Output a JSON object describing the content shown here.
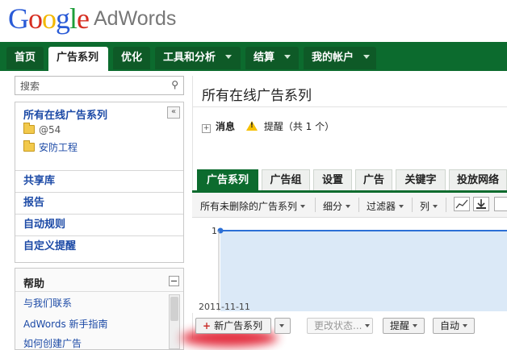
{
  "logo": {
    "brand_letters": [
      "G",
      "o",
      "o",
      "g",
      "l",
      "e"
    ],
    "product": "AdWords"
  },
  "nav": {
    "tabs": [
      {
        "label": "首页",
        "active": false,
        "dropdown": false
      },
      {
        "label": "广告系列",
        "active": true,
        "dropdown": false
      },
      {
        "label": "优化",
        "active": false,
        "dropdown": false
      },
      {
        "label": "工具和分析",
        "active": false,
        "dropdown": true
      },
      {
        "label": "结算",
        "active": false,
        "dropdown": true
      },
      {
        "label": "我的帐户",
        "active": false,
        "dropdown": true
      }
    ]
  },
  "sidebar": {
    "search_placeholder": "搜索",
    "tree_title": "所有在线广告系列",
    "collapse_label": "«",
    "campaigns": [
      "@54",
      "安防工程"
    ],
    "links": [
      "共享库",
      "报告",
      "自动规则",
      "自定义提醒"
    ],
    "help": {
      "title": "帮助",
      "links": [
        "与我们联系",
        "AdWords 新手指南",
        "如何创建广告"
      ]
    }
  },
  "main": {
    "page_title": "所有在线广告系列",
    "messages_label": "消息",
    "alerts_label": "提醒（共 1 个）",
    "tabs": [
      "广告系列",
      "广告组",
      "设置",
      "广告",
      "关键字",
      "投放网络"
    ],
    "toolbar": {
      "filter_view": "所有未删除的广告系列",
      "segment": "细分",
      "filter": "过滤器",
      "columns": "列"
    },
    "chart_date": "2011-11-11",
    "chart_y_tick": "1",
    "actions": {
      "new_campaign": "新广告系列",
      "change_status": "更改状态...",
      "alerts": "提醒",
      "automate": "自动"
    }
  },
  "colors": {
    "nav_green": "#0c6b2e",
    "link_blue": "#1c4aa6",
    "chart_line": "#2b6fd6",
    "chart_fill": "#dbe9f7"
  }
}
